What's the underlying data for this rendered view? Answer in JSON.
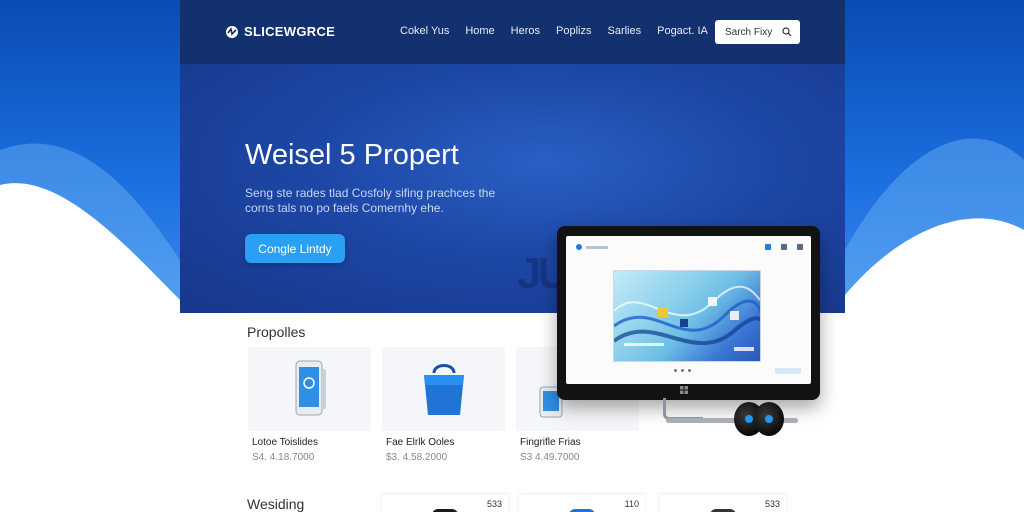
{
  "header": {
    "logo_text": "SLICEWGRCE",
    "nav": [
      "Cokel Yus",
      "Home",
      "Heros",
      "Poplizs",
      "Sarlies",
      "Pogact. IA"
    ],
    "search": {
      "placeholder": "Sarch Fixy",
      "icon": "search-icon"
    }
  },
  "hero": {
    "title": "Weisel 5 Propert",
    "subtitle": "Seng ste rades tlad Cosfoly sifing prachces the corns tals no po faels Comernhy ehe.",
    "cta_label": "Congle Lintdy",
    "watermark": "JU"
  },
  "products": {
    "title": "Propolles",
    "items": [
      {
        "name": "Lotoe Toislides",
        "price": "S4. 4.18.7000",
        "icon": "smartphone-icon"
      },
      {
        "name": "Fae Elrlk Ooles",
        "price": "$3. 4.58.2000",
        "icon": "shopping-bag-icon"
      },
      {
        "name": "Fingrifle Frias",
        "price": "S3 4.49.7000",
        "icon": "phone-icon"
      }
    ]
  },
  "second_section": {
    "title": "Wesiding",
    "items": [
      {
        "count": "533"
      },
      {
        "count": "110"
      },
      {
        "count": "533"
      }
    ]
  },
  "colors": {
    "header_bg": "#13316f",
    "hero_bg": "#1d47a6",
    "accent": "#2aa0f5",
    "side_waves": "#1c6fe0"
  }
}
